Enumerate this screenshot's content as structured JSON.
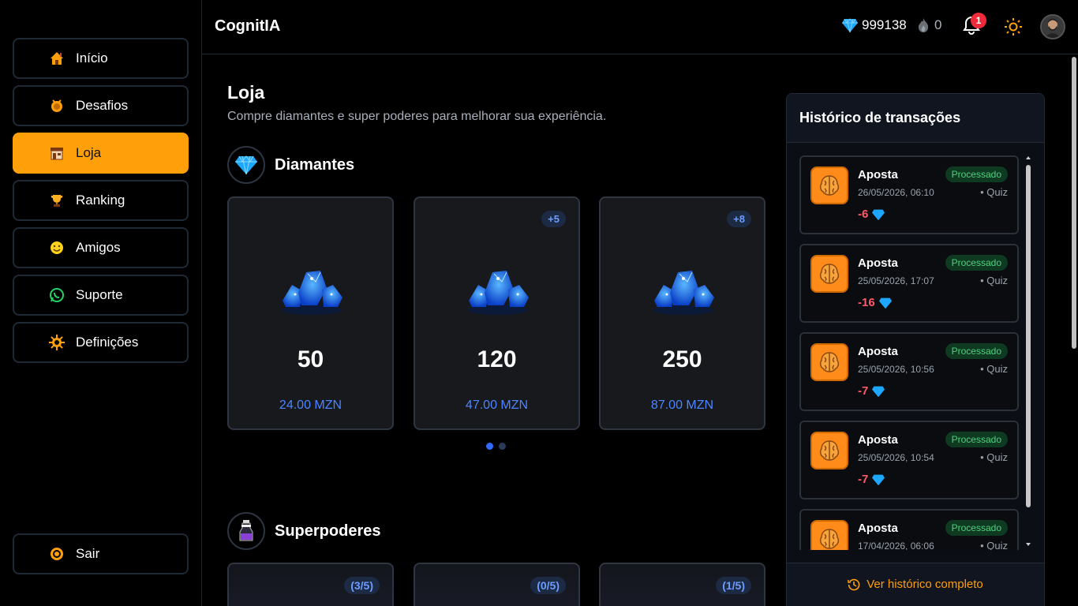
{
  "app": {
    "brand": "CognitIA"
  },
  "sidebar": {
    "items": [
      {
        "label": "Início",
        "icon": "home-icon"
      },
      {
        "label": "Desafios",
        "icon": "badge-icon"
      },
      {
        "label": "Loja",
        "icon": "store-icon",
        "active": true
      },
      {
        "label": "Ranking",
        "icon": "trophy-icon"
      },
      {
        "label": "Amigos",
        "icon": "smiley-icon"
      },
      {
        "label": "Suporte",
        "icon": "whatsapp-icon"
      },
      {
        "label": "Definições",
        "icon": "gear-icon"
      }
    ],
    "logout": {
      "label": "Sair",
      "icon": "logout-icon"
    }
  },
  "topbar": {
    "diamonds": "999138",
    "streak": "0",
    "notifications": "1"
  },
  "page": {
    "title": "Loja",
    "subtitle": "Compre diamantes e super poderes para melhorar sua experiência."
  },
  "diamonds": {
    "title": "Diamantes",
    "packs": [
      {
        "amount": "50",
        "price": "24.00 MZN",
        "bonus": ""
      },
      {
        "amount": "120",
        "price": "47.00 MZN",
        "bonus": "+5"
      },
      {
        "amount": "250",
        "price": "87.00 MZN",
        "bonus": "+8"
      }
    ]
  },
  "powers": {
    "title": "Superpoderes",
    "items": [
      {
        "count": "(3/5)"
      },
      {
        "count": "(0/5)"
      },
      {
        "count": "(1/5)"
      }
    ]
  },
  "history": {
    "title": "Histórico de transações",
    "footer": "Ver histórico completo",
    "items": [
      {
        "kind": "Aposta",
        "status": "Processado",
        "date": "26/05/2026, 06:10",
        "type": "• Quiz",
        "delta": "-6"
      },
      {
        "kind": "Aposta",
        "status": "Processado",
        "date": "25/05/2026, 17:07",
        "type": "• Quiz",
        "delta": "-16"
      },
      {
        "kind": "Aposta",
        "status": "Processado",
        "date": "25/05/2026, 10:56",
        "type": "• Quiz",
        "delta": "-7"
      },
      {
        "kind": "Aposta",
        "status": "Processado",
        "date": "25/05/2026, 10:54",
        "type": "• Quiz",
        "delta": "-7"
      },
      {
        "kind": "Aposta",
        "status": "Processado",
        "date": "17/04/2026, 06:06",
        "type": "• Quiz",
        "delta": ""
      }
    ]
  },
  "colors": {
    "accent": "#ff9f0a",
    "diamond": "#1ea7ff",
    "price": "#4d84ff",
    "negative": "#ff5a6b",
    "success": "#4fd07e"
  }
}
